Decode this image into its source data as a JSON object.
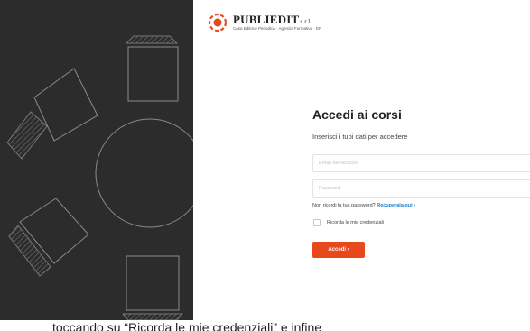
{
  "logo": {
    "name": "PUBLIEDIT",
    "suffix": "s.r.l.",
    "tagline": "Casa Editrice Periodica · Agenzia Formativa · EP"
  },
  "form": {
    "title": "Accedi ai corsi",
    "subtitle": "Inserisci i tuoi dati per accedere",
    "email_placeholder": "Email dell'account",
    "password_placeholder": "Password",
    "forgot_text": "Non ricordi la tua password?",
    "forgot_link": "Recuperala qui ›",
    "remember_label": "Ricorda le mie credenziali",
    "submit_label": "Accedi ›"
  },
  "bottom_text": "toccando su “Ricorda le mie credenziali” e infine",
  "colors": {
    "accent": "#e8481c",
    "link": "#1e7fcf",
    "panel": "#2c2c2c"
  },
  "icons": {
    "logo": "target-logo-icon",
    "checkbox": "checkbox-icon"
  }
}
